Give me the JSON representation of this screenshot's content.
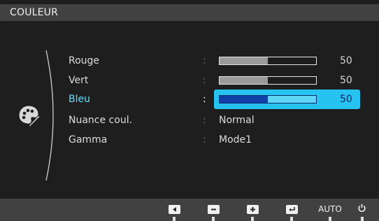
{
  "menu": {
    "title": "COULEUR",
    "icon": "palette-icon",
    "items": [
      {
        "label": "Rouge",
        "type": "slider",
        "value": 50,
        "max": 100,
        "selected": false
      },
      {
        "label": "Vert",
        "type": "slider",
        "value": 50,
        "max": 100,
        "selected": false
      },
      {
        "label": "Bleu",
        "type": "slider",
        "value": 50,
        "max": 100,
        "selected": true
      },
      {
        "label": "Nuance coul.",
        "type": "option",
        "value": "Normal",
        "selected": false
      },
      {
        "label": "Gamma",
        "type": "option",
        "value": "Mode1",
        "selected": false
      }
    ],
    "separator": ":"
  },
  "footer": {
    "buttons": [
      {
        "icon": "left-arrow-icon"
      },
      {
        "icon": "minus-icon"
      },
      {
        "icon": "plus-icon"
      },
      {
        "icon": "enter-icon"
      },
      {
        "label": "AUTO"
      },
      {
        "icon": "power-icon"
      }
    ]
  },
  "colors": {
    "background": "#1e1e1e",
    "bars": "#414141",
    "highlight": "#27c3f0",
    "selected_label": "#5ee0ff"
  }
}
